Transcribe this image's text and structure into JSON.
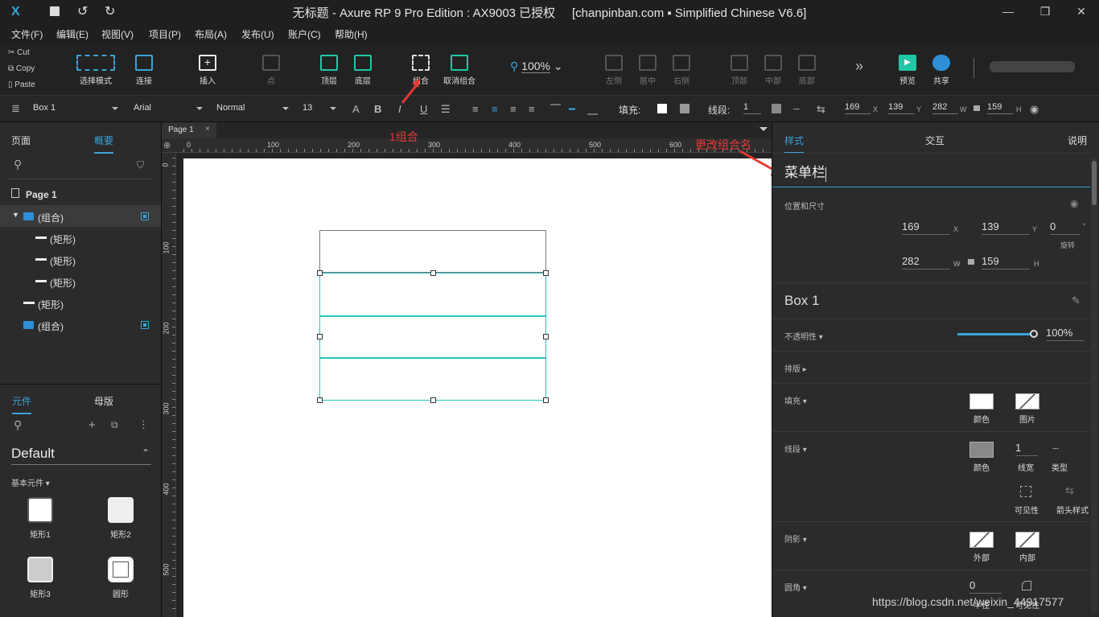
{
  "window": {
    "title": "无标题 - Axure RP 9 Pro Edition : AX9003 已授权     [chanpinban.com ▪ Simplified Chinese V6.6]"
  },
  "menu": [
    "文件(F)",
    "编辑(E)",
    "视图(V)",
    "项目(P)",
    "布局(A)",
    "发布(U)",
    "账户(C)",
    "帮助(H)"
  ],
  "clipboard": {
    "cut": "Cut",
    "copy": "Copy",
    "paste": "Paste"
  },
  "toolbar": {
    "select_mode": "选择模式",
    "connect": "连接",
    "insert": "插入",
    "point": "点",
    "to_front": "顶层",
    "to_back": "底层",
    "group": "组合",
    "ungroup": "取消组合",
    "zoom": "100%",
    "align_left": "左侧",
    "align_center": "居中",
    "align_right": "右侧",
    "align_top": "顶部",
    "align_middle": "中部",
    "align_bottom": "底部",
    "more": "»",
    "preview": "预览",
    "share": "共享"
  },
  "format": {
    "style": "Box 1",
    "font": "Arial",
    "weight": "Normal",
    "size": "13",
    "fill_label": "填充:",
    "stroke_label": "线段:",
    "stroke_width": "1",
    "x": "169",
    "y": "139",
    "w": "282",
    "h": "159",
    "x_lbl": "X",
    "y_lbl": "Y",
    "w_lbl": "W",
    "h_lbl": "H"
  },
  "left": {
    "tabs": [
      "页面",
      "概要"
    ],
    "tree": [
      {
        "label": "Page 1"
      },
      {
        "label": "(组合)"
      },
      {
        "label": "(矩形)"
      },
      {
        "label": "(矩形)"
      },
      {
        "label": "(矩形)"
      },
      {
        "label": "(矩形)"
      },
      {
        "label": "(组合)"
      }
    ],
    "lib_tabs": [
      "元件",
      "母版"
    ],
    "library": "Default",
    "section": "基本元件 ▾",
    "widgets": [
      "矩形1",
      "矩形2",
      "矩形3",
      "圆形"
    ]
  },
  "canvas": {
    "page_tab": "Page 1",
    "ruler_h": [
      "0",
      "100",
      "200",
      "300",
      "400",
      "500",
      "600"
    ],
    "ruler_v": [
      "0",
      "100",
      "200",
      "300",
      "400",
      "500"
    ]
  },
  "annotations": {
    "group": "1组合",
    "rename": "更改组合名"
  },
  "right": {
    "tabs": [
      "样式",
      "交互",
      "说明"
    ],
    "name": "菜单栏",
    "pos_size": "位置和尺寸",
    "x": "169",
    "y": "139",
    "rotate": "0",
    "w": "282",
    "h": "159",
    "x_lbl": "X",
    "y_lbl": "Y",
    "deg": "°",
    "w_lbl": "W",
    "h_lbl": "H",
    "rotate_lbl": "旋转",
    "style_name": "Box 1",
    "opacity_lbl": "不透明性 ▾",
    "opacity": "100%",
    "opacity_fraction": 1.0,
    "layout_lbl": "排版 ▸",
    "fill_lbl": "填充 ▾",
    "fill_color": "颜色",
    "fill_image": "图片",
    "stroke_lbl": "线段 ▾",
    "stroke_color": "颜色",
    "stroke_width": "1",
    "stroke_width_lbl": "线宽",
    "stroke_type": "类型",
    "visibility": "可见性",
    "arrow": "箭头样式",
    "shadow_lbl": "阴影 ▾",
    "shadow_out": "外部",
    "shadow_in": "内部",
    "radius_lbl": "圆角 ▾",
    "radius": "0",
    "radius_w": "半径",
    "radius_vis": "可见性"
  },
  "watermark": "https://blog.csdn.net/weixin_44917577",
  "colors": {
    "accent": "#3aa3d9",
    "annotation": "#e53935",
    "selection": "#1fc7c7"
  }
}
